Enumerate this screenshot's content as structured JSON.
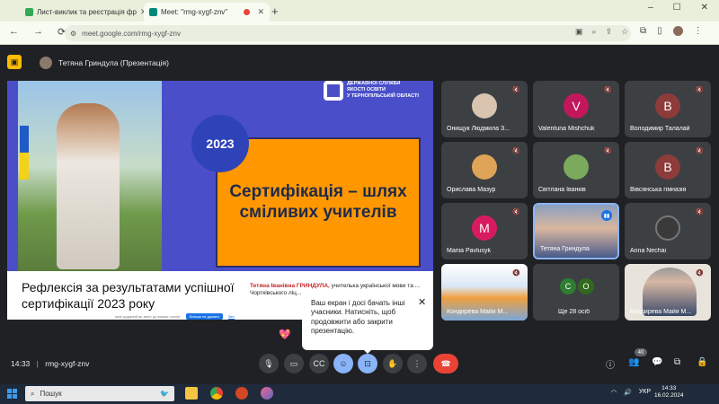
{
  "browser": {
    "tabs": [
      {
        "title": "Лист-виклик та реєстрація фр",
        "favicon_color": "#34a853"
      },
      {
        "title": "Meet: \"rmg-xygf-znv\"",
        "favicon_color": "#00897b",
        "active": true,
        "recording_dot": "#ea4335"
      }
    ],
    "new_tab": "+",
    "window_controls": [
      "–",
      "☐",
      "✕"
    ],
    "nav": {
      "back": "←",
      "forward": "→",
      "reload": "⟳"
    },
    "url": "meet.google.com/rmg-xygf-znv"
  },
  "meet": {
    "presenter_label": "Тетяна Гриндула (Презентація)",
    "slide": {
      "year": "2023",
      "org_lines": [
        "ДЕРЖАВНОЇ СЛУЖБИ",
        "ЯКОСТІ ОСВІТИ",
        "У ТЕРНОПІЛЬСЬКІЙ ОБЛАСТІ"
      ],
      "headline_lines": [
        "Сертифікація – шлях",
        "сміливих учителів"
      ],
      "caption": "Рефлексія за результатами успішної сертифікації 2023 року",
      "credit_name": "Тетяна Іванівна ГРИНДУЛА,",
      "credit_rest": " учителька української мови та ... Чортківського ліц..."
    },
    "web_banner": {
      "text": "мені доданий ви зміст до ваших послуг",
      "button": "Більше не думати",
      "link": "Звіт"
    },
    "participants": [
      {
        "name": "Онищук Людмила З...",
        "type": "photo",
        "color": "#d9c4b0",
        "muted": true
      },
      {
        "name": "Valentuna Mishchuk",
        "type": "initial",
        "initial": "V",
        "color": "#c2185b",
        "muted": true
      },
      {
        "name": "Володимир Талалай",
        "type": "initial",
        "initial": "B",
        "color": "#8d3b3b",
        "muted": true
      },
      {
        "name": "Орислава Мазур",
        "type": "photo",
        "color": "#e0a458",
        "muted": true
      },
      {
        "name": "Світлана Іванків",
        "type": "photo",
        "color": "#7caa5c",
        "muted": true
      },
      {
        "name": "Вівсянська гімназія",
        "type": "initial",
        "initial": "B",
        "color": "#8d3b3b",
        "muted": true
      },
      {
        "name": "Mariia Pavlusyk",
        "type": "initial",
        "initial": "M",
        "color": "#d81b60",
        "muted": true
      },
      {
        "name": "Тетяна Гриндула",
        "type": "video",
        "speaking": true
      },
      {
        "name": "Anna Nechai",
        "type": "photo",
        "color": "#3a3a3a",
        "muted": true
      },
      {
        "name": "Кондирева Майя М...",
        "type": "video",
        "muted": true
      },
      {
        "name": "Ще 28 осіб",
        "type": "more",
        "minis": [
          {
            "initial": "С",
            "color": "#2e7d32"
          },
          {
            "initial": "O",
            "color": "#33691e"
          }
        ]
      },
      {
        "name": "Кондирева Майя М...",
        "type": "video",
        "muted": true
      }
    ],
    "tooltip": "Ваш екран і досі бачать інші учасники. Натисніть, щоб продовжити або закрити презентацію.",
    "time": "14:33",
    "meeting_code": "rmg-xygf-znv",
    "separator": "|",
    "controls": {
      "mic": "🎙",
      "camera": "▭",
      "captions": "CC",
      "emoji": "☺",
      "present": "⊡",
      "hand": "✋",
      "more": "⋮",
      "end": "☎"
    },
    "right_controls": {
      "info": "ⓘ",
      "people": "👥",
      "chat": "💬",
      "activities": "⧉",
      "lock": "🔒"
    },
    "participant_count": "40"
  },
  "taskbar": {
    "search_placeholder": "Пошук",
    "language": "УКР",
    "time": "14:33",
    "date": "16.02.2024"
  }
}
